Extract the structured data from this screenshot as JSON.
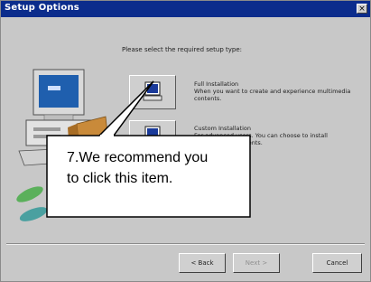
{
  "window": {
    "title": "Setup Options",
    "close_label": "×"
  },
  "instruction": "Please select the required setup type:",
  "options": [
    {
      "title": "Full Installation",
      "description": "When you want to create and experience multimedia contents."
    },
    {
      "title": "Custom Installation",
      "description": "For advanced users. You can choose to install individual components."
    }
  ],
  "callout": {
    "line1": "7.We recommend you",
    "line2": "to click this item."
  },
  "buttons": {
    "back": "< Back",
    "next": "Next >",
    "cancel": "Cancel"
  },
  "colors": {
    "titlebar": "#0b2c8c",
    "monitor_screen": "#1f5fae",
    "callout_border": "#000000"
  }
}
